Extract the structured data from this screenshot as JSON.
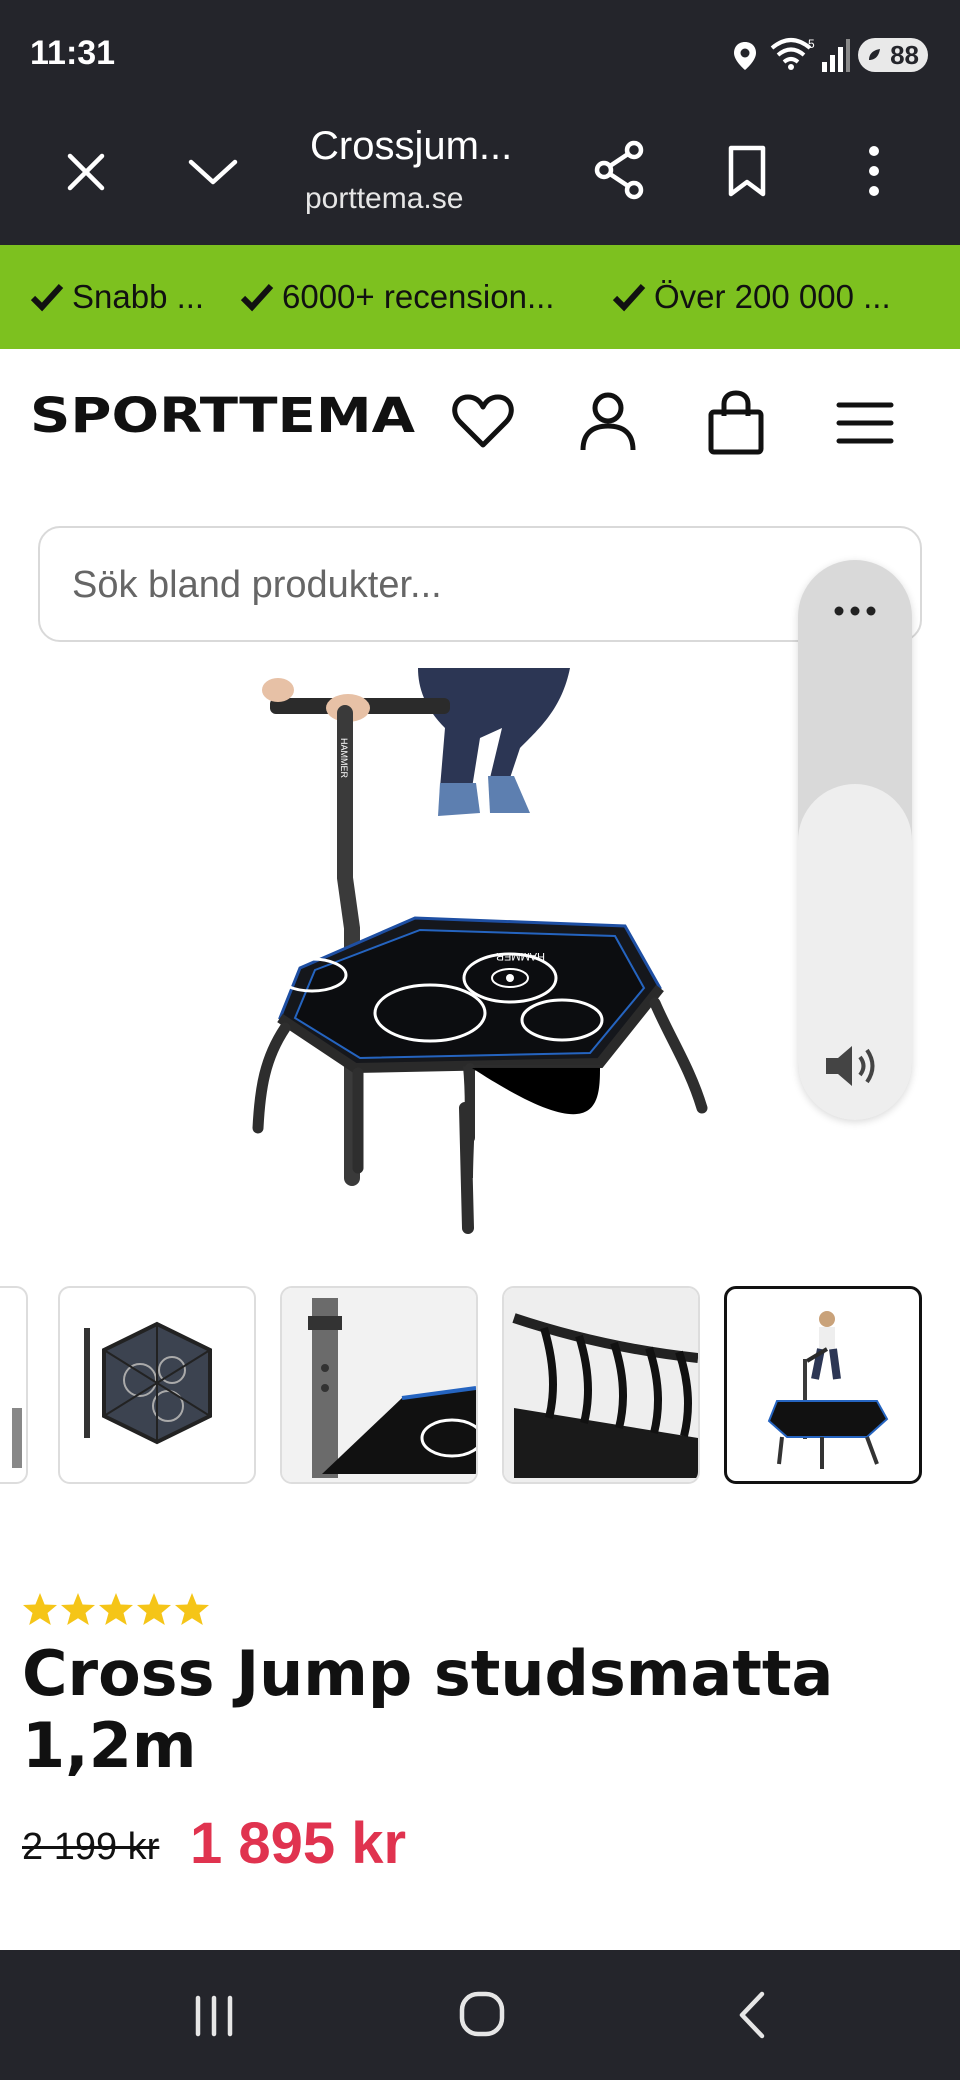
{
  "status_bar": {
    "time": "11:31",
    "battery": "88"
  },
  "browser": {
    "title": "Crossjum...",
    "url": "porttema.se"
  },
  "banner": {
    "items": [
      "Snabb ...",
      "6000+ recension...",
      "Över 200 000 ..."
    ],
    "color": "#7dc11f"
  },
  "header": {
    "logo_text": "SPORTTEMA"
  },
  "search": {
    "placeholder": "Sök bland produkter..."
  },
  "product": {
    "rating_stars": 5,
    "title": "Cross Jump studsmatta 1,2m",
    "old_price": "2 199 kr",
    "price": "1 895 kr",
    "price_color": "#e0334f",
    "star_color": "#f5c518"
  },
  "image": {
    "brand_text": "HAMMER"
  },
  "volume": {
    "level": 0.6
  }
}
